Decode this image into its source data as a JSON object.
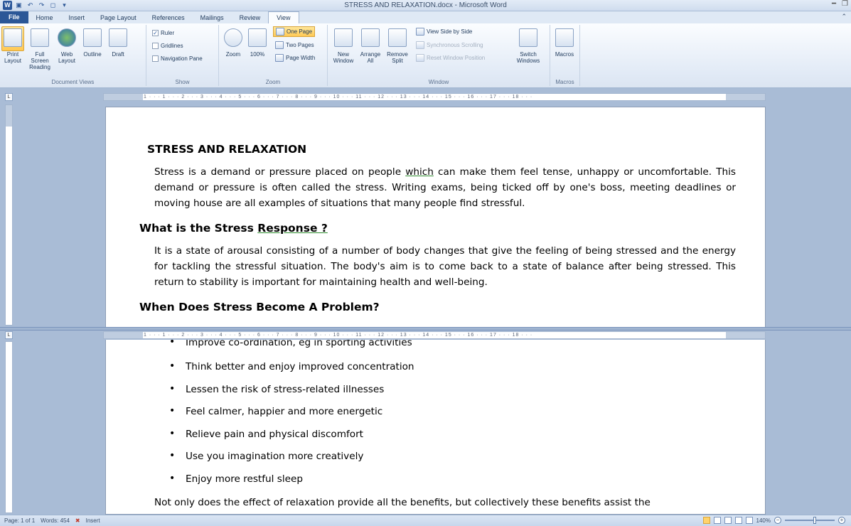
{
  "window": {
    "title": "STRESS AND RELAXATION.docx - Microsoft Word",
    "quick_access": [
      "W",
      "save",
      "undo",
      "redo",
      "new",
      "customize"
    ]
  },
  "tabs": [
    "File",
    "Home",
    "Insert",
    "Page Layout",
    "References",
    "Mailings",
    "Review",
    "View"
  ],
  "active_tab": "View",
  "ribbon": {
    "document_views": {
      "label": "Document Views",
      "buttons": [
        "Print Layout",
        "Full Screen Reading",
        "Web Layout",
        "Outline",
        "Draft"
      ]
    },
    "show": {
      "label": "Show",
      "ruler": "Ruler",
      "gridlines": "Gridlines",
      "navigation_pane": "Navigation Pane"
    },
    "zoom": {
      "label": "Zoom",
      "zoom": "Zoom",
      "hundred": "100%",
      "one_page": "One Page",
      "two_pages": "Two Pages",
      "page_width": "Page Width"
    },
    "window": {
      "label": "Window",
      "new_window": "New Window",
      "arrange_all": "Arrange All",
      "remove_split": "Remove Split",
      "view_side_by_side": "View Side by Side",
      "synchronous_scrolling": "Synchronous Scrolling",
      "reset_window_position": "Reset Window Position",
      "switch_windows": "Switch Windows"
    },
    "macros": {
      "label": "Macros",
      "macros": "Macros"
    }
  },
  "ruler_ticks": "1 · · · 1 · · · 2 · · · 3 · · · 4 · · · 5 · · · 6 · · · 7 · · · 8 · · · 9 · · · 10 · · · 11 · · · 12 · · · 13 · · · 14 · · · 15 · · · 16 · · · 17 · · · 18 · · ·",
  "document": {
    "title": "STRESS AND RELAXATION",
    "para1_before": "Stress is a demand or pressure placed on people ",
    "para1_underlined": "which",
    "para1_after": " can make them feel tense, unhappy or uncomfortable. This demand or pressure is often called the stress. Writing exams, being ticked off by one's boss, meeting deadlines or moving house are all examples of situations that many people find stressful.",
    "heading2_before": "What is the Stress ",
    "heading2_underlined": "Response ?",
    "para2": "It is a state of arousal consisting of a number of body changes that give the feeling of being stressed and the energy for tackling the stressful situation. The body's aim is to come back to a state of balance after being stressed.    This return to stability is important for maintaining health and well-being.",
    "heading3": "When Does Stress Become A Problem?",
    "partial_bullet": "Improve co-ordination, eg in sporting activities",
    "bullets": [
      "Think better and enjoy improved concentration",
      "Lessen the risk of stress-related illnesses",
      "Feel calmer, happier and more energetic",
      "Relieve pain and physical discomfort",
      "Use you imagination more creatively",
      "Enjoy more restful sleep"
    ],
    "closing_para": "Not only does the effect of relaxation provide all the benefits, but collectively these benefits assist the"
  },
  "statusbar": {
    "page": "Page: 1 of 1",
    "words": "Words: 454",
    "mode": "Insert",
    "zoom": "140%"
  }
}
